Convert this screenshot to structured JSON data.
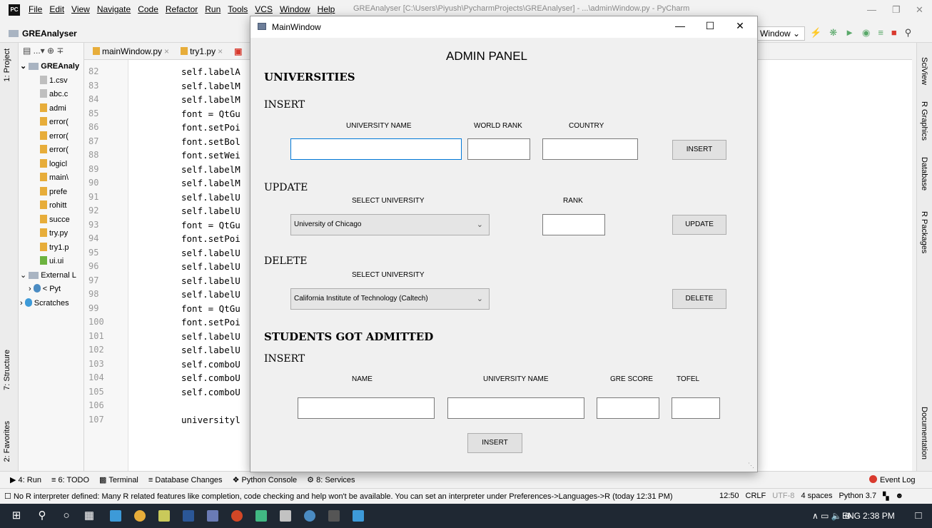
{
  "ide": {
    "menu": [
      "File",
      "Edit",
      "View",
      "Navigate",
      "Code",
      "Refactor",
      "Run",
      "Tools",
      "VCS",
      "Window",
      "Help"
    ],
    "window_title": "GREAnalyser [C:\\Users\\Piyush\\PycharmProjects\\GREAnalyser] - ...\\adminWindow.py - PyCharm",
    "project_name": "GREAnalyser",
    "run_config": "Window",
    "tabs": [
      "mainWindow.py",
      "try1.py"
    ],
    "project_tree": {
      "toolbar": "▤ ...▾ ⊕ ∓",
      "root": "GREAnaly",
      "items": [
        "1.csv",
        "abc.c",
        "admi",
        "error(",
        "error(",
        "error(",
        "logicl",
        "main\\",
        "prefe",
        "rohitt",
        "succe",
        "try.py",
        "try1.p",
        "ui.ui"
      ],
      "external": "External L",
      "python": "< Pyt",
      "scratches": "Scratches"
    },
    "code_lines": [
      {
        "n": "82",
        "text": "self.labelA"
      },
      {
        "n": "83",
        "text": "self.labelM"
      },
      {
        "n": "84",
        "text": "self.labelM"
      },
      {
        "n": "85",
        "text": "font = QtGu"
      },
      {
        "n": "86",
        "text": "font.setPoi"
      },
      {
        "n": "87",
        "text": "font.setBol"
      },
      {
        "n": "88",
        "text": "font.setWei"
      },
      {
        "n": "89",
        "text": "self.labelM"
      },
      {
        "n": "90",
        "text": "self.labelM"
      },
      {
        "n": "91",
        "text": "self.labelU"
      },
      {
        "n": "92",
        "text": "self.labelU"
      },
      {
        "n": "93",
        "text": "font = QtGu"
      },
      {
        "n": "94",
        "text": "font.setPoi"
      },
      {
        "n": "95",
        "text": "self.labelU"
      },
      {
        "n": "96",
        "text": "self.labelU"
      },
      {
        "n": "97",
        "text": "self.labelU"
      },
      {
        "n": "98",
        "text": "self.labelU"
      },
      {
        "n": "99",
        "text": "font = QtGu"
      },
      {
        "n": "100",
        "text": "font.setPoi"
      },
      {
        "n": "101",
        "text": "self.labelU"
      },
      {
        "n": "102",
        "text": "self.labelU"
      },
      {
        "n": "103",
        "text": "self.comboU"
      },
      {
        "n": "104",
        "text": "self.comboU"
      },
      {
        "n": "105",
        "text": "self.comboU"
      },
      {
        "n": "106",
        "text": ""
      },
      {
        "n": "107",
        "text": "universityl"
      }
    ],
    "left_tools": [
      "1: Project",
      "7: Structure",
      "2: Favorites"
    ],
    "right_tools": [
      "SciView",
      "R Graphics",
      "Database",
      "R Packages",
      "Documentation"
    ],
    "bottom_tools": [
      "4: Run",
      "6: TODO",
      "Terminal",
      "Database Changes",
      "Python Console",
      "8: Services"
    ],
    "event_log": "Event Log",
    "status_message": "No R interpreter defined: Many R related features like completion, code checking and help won't be available. You can set an interpreter under Preferences->Languages->R (today 12:31 PM)",
    "status_right": [
      "12:50",
      "CRLF",
      "UTF-8",
      "4 spaces",
      "Python 3.7"
    ]
  },
  "taskbar": {
    "tray": "∧  ▭  🔈  ⊕",
    "lang": "ENG",
    "time": "2:38 PM"
  },
  "admin": {
    "window_title": "MainWindow",
    "panel_title": "ADMIN PANEL",
    "universities": {
      "heading": "UNIVERSITIES",
      "insert": {
        "label": "INSERT",
        "col_name": "UNIVERSITY NAME",
        "col_rank": "WORLD RANK",
        "col_country": "COUNTRY",
        "name_value": "",
        "rank_value": "",
        "country_value": "",
        "button": "INSERT"
      },
      "update": {
        "label": "UPDATE",
        "select_label": "SELECT UNIVERSITY",
        "selected": "University of Chicago",
        "rank_label": "RANK",
        "rank_value": "",
        "button": "UPDATE"
      },
      "delete": {
        "label": "DELETE",
        "select_label": "SELECT UNIVERSITY",
        "selected": "California Institute of Technology (Caltech)",
        "button": "DELETE"
      }
    },
    "students": {
      "heading": "STUDENTS GOT ADMITTED",
      "insert": {
        "label": "INSERT",
        "col_name": "NAME",
        "col_university": "UNIVERSITY NAME",
        "col_gre": "GRE SCORE",
        "col_tofel": "TOFEL",
        "name_value": "",
        "university_value": "",
        "gre_value": "",
        "tofel_value": "",
        "button": "INSERT"
      }
    }
  }
}
